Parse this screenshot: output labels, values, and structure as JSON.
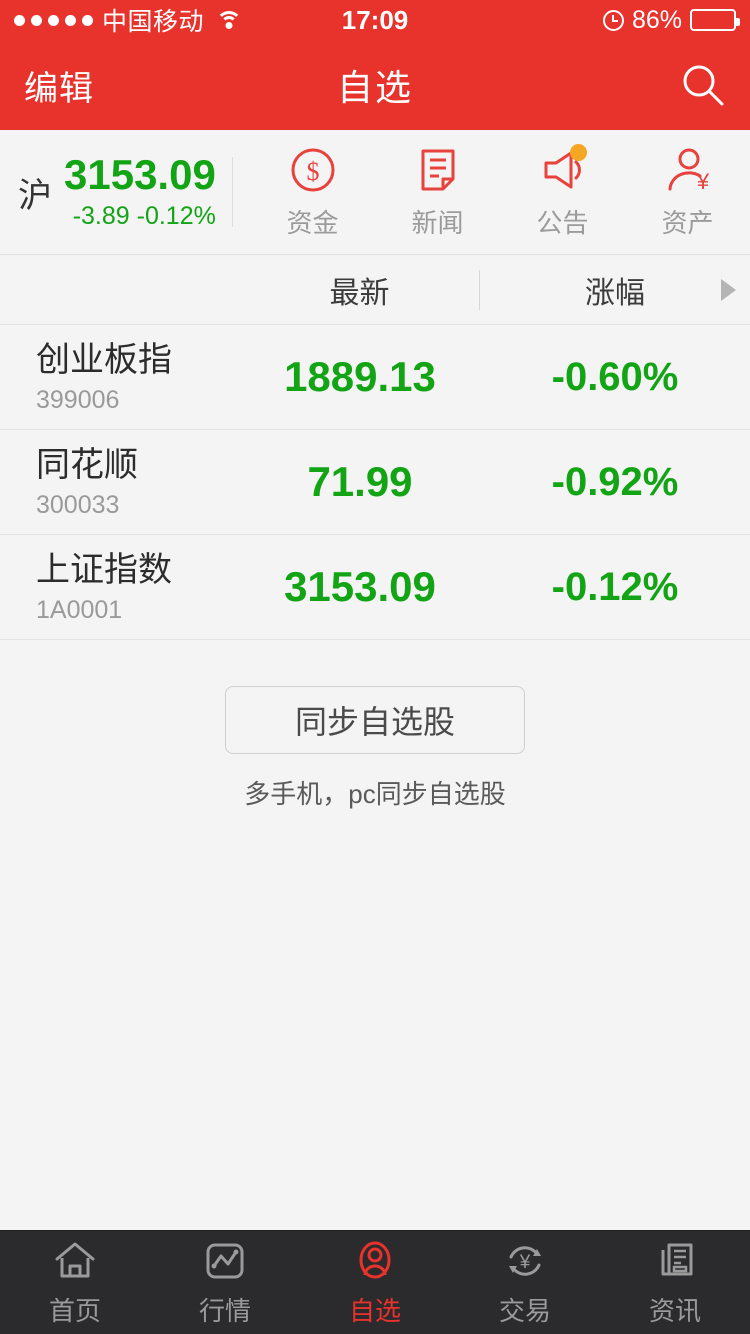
{
  "status_bar": {
    "signal_dots": 5,
    "carrier": "中国移动",
    "wifi_icon": "wifi-icon",
    "time": "17:09",
    "alarm_icon": "alarm-clock-icon",
    "battery_percent": "86%",
    "battery_level": 86
  },
  "nav": {
    "edit_label": "编辑",
    "title": "自选",
    "search_icon": "search-icon"
  },
  "index_panel": {
    "market_label": "沪",
    "price": "3153.09",
    "delta": "-3.89 -0.12%",
    "down_color": "#13a415",
    "actions": [
      {
        "icon": "dollar-circle-icon",
        "label": "资金",
        "badge": false
      },
      {
        "icon": "news-document-icon",
        "label": "新闻",
        "badge": false
      },
      {
        "icon": "megaphone-icon",
        "label": "公告",
        "badge": true
      },
      {
        "icon": "person-yuan-icon",
        "label": "资产",
        "badge": false
      }
    ],
    "badge_color": "#f5a623",
    "icon_color": "#e8423c"
  },
  "list_header": {
    "name_column": "",
    "latest_column": "最新",
    "change_column": "涨幅",
    "sort_arrow_icon": "triangle-right-icon"
  },
  "stocks": [
    {
      "name": "创业板指",
      "code": "399006",
      "price": "1889.13",
      "change": "-0.60%"
    },
    {
      "name": "同花顺",
      "code": "300033",
      "price": "71.99",
      "change": "-0.92%"
    },
    {
      "name": "上证指数",
      "code": "1A0001",
      "price": "3153.09",
      "change": "-0.12%"
    }
  ],
  "sync": {
    "button_label": "同步自选股",
    "hint": "多手机，pc同步自选股"
  },
  "tab_bar": {
    "active_index": 2,
    "active_color": "#e8322c",
    "inactive_color": "#9a9a9a",
    "items": [
      {
        "icon": "home-icon",
        "label": "首页"
      },
      {
        "icon": "line-chart-icon",
        "label": "行情"
      },
      {
        "icon": "person-oval-icon",
        "label": "自选"
      },
      {
        "icon": "yuan-refresh-icon",
        "label": "交易"
      },
      {
        "icon": "newspaper-icon",
        "label": "资讯"
      }
    ]
  },
  "theme": {
    "brand_red": "#e8322c",
    "background": "#f4f4f4",
    "tabbar_background": "#2b2b2d"
  }
}
